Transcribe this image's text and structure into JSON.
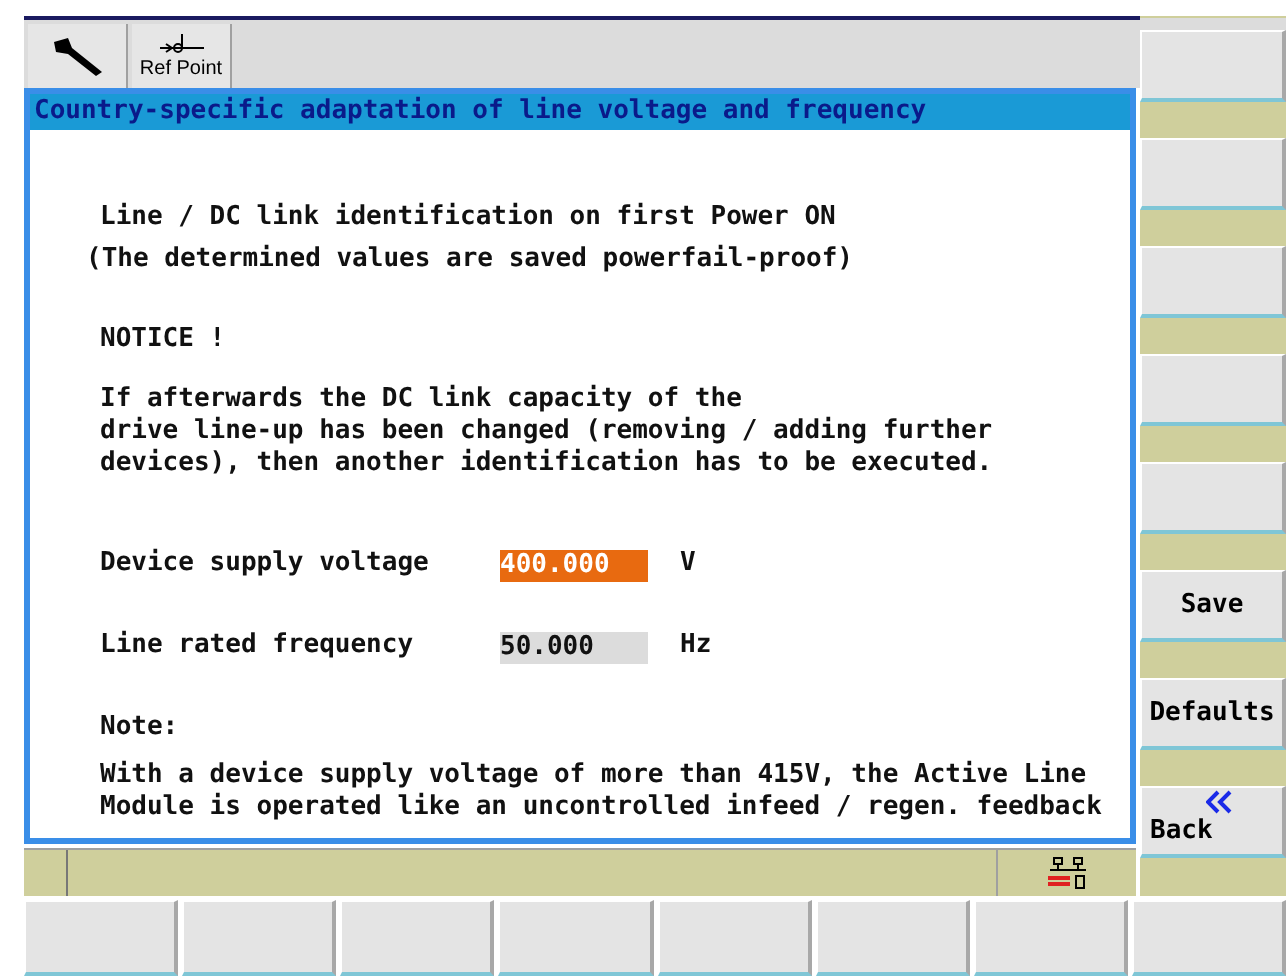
{
  "toolbar": {
    "buttons": [
      {
        "kind": "wrench"
      },
      {
        "kind": "refpoint",
        "label": "Ref Point"
      }
    ]
  },
  "dialog": {
    "title": "Country-specific adaptation of line voltage and frequency",
    "heading": "Line / DC link identification on first Power ON",
    "subheading": "(The determined values are saved powerfail-proof)",
    "notice_title": "NOTICE !",
    "notice_lines": [
      "If afterwards the DC link capacity of the",
      "drive line-up has been changed (removing / adding further",
      "devices), then another identification has to be executed."
    ],
    "fields": [
      {
        "label": "Device supply voltage",
        "value": "400.000",
        "unit": "V",
        "focused": true
      },
      {
        "label": "Line rated frequency",
        "value": "50.000",
        "unit": "Hz",
        "focused": false
      }
    ],
    "note_title": "Note:",
    "note_lines": [
      "With a device supply voltage of more than 415V, the Active Line",
      "Module is operated like an uncontrolled infeed / regen. feedback"
    ]
  },
  "vertical_softkeys": [
    {
      "kind": "blank"
    },
    {
      "kind": "blank"
    },
    {
      "kind": "blank"
    },
    {
      "kind": "blank"
    },
    {
      "kind": "blank"
    },
    {
      "kind": "text",
      "label": "Save"
    },
    {
      "kind": "text",
      "label": "Defaults"
    },
    {
      "kind": "back",
      "label": "Back"
    }
  ],
  "horizontal_softkeys": [
    {
      "kind": "blank"
    },
    {
      "kind": "blank"
    },
    {
      "kind": "blank"
    },
    {
      "kind": "blank"
    },
    {
      "kind": "blank"
    },
    {
      "kind": "blank"
    },
    {
      "kind": "blank"
    },
    {
      "kind": "blank"
    }
  ]
}
